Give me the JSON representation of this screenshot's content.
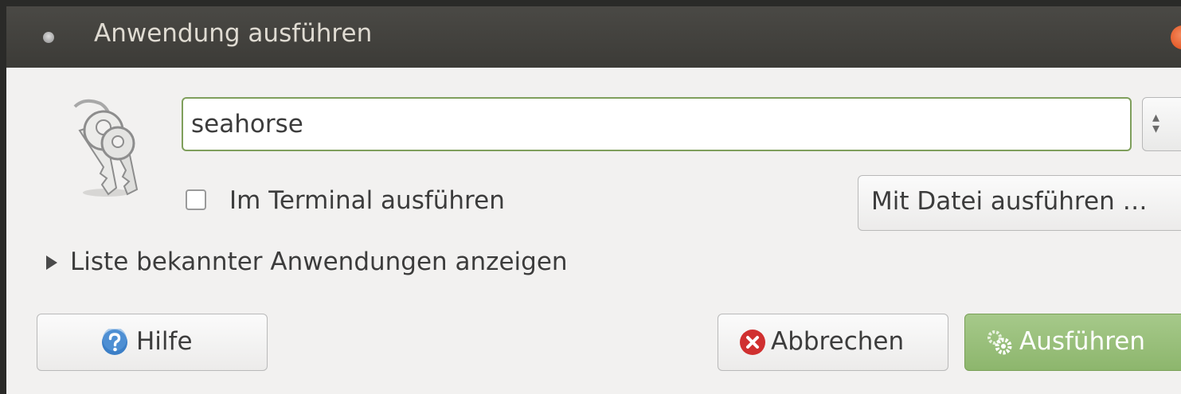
{
  "window": {
    "title": "Anwendung ausführen"
  },
  "command": {
    "value": "seahorse"
  },
  "options": {
    "terminal_label": "Im Terminal ausführen",
    "terminal_checked": false,
    "file_button_label": "Mit Datei ausführen …"
  },
  "expander": {
    "label": "Liste bekannter Anwendungen anzeigen",
    "expanded": false
  },
  "buttons": {
    "help_label": "Hilfe",
    "cancel_label": "Abbrechen",
    "run_label": "Ausführen"
  },
  "icons": {
    "app_icon": "keys-icon",
    "help_icon": "help-icon",
    "cancel_icon": "cancel-icon",
    "run_icon": "gears-icon",
    "close_icon": "close-icon",
    "dropdown_icon": "spin-arrows-icon"
  },
  "colors": {
    "titlebar": "#3c3b37",
    "window_bg": "#f2f1f0",
    "input_focus_border": "#7f9f5c",
    "run_button": "#8db66d",
    "close_button": "#dd4814",
    "help_icon": "#3c7fc7",
    "cancel_icon": "#d03030"
  }
}
